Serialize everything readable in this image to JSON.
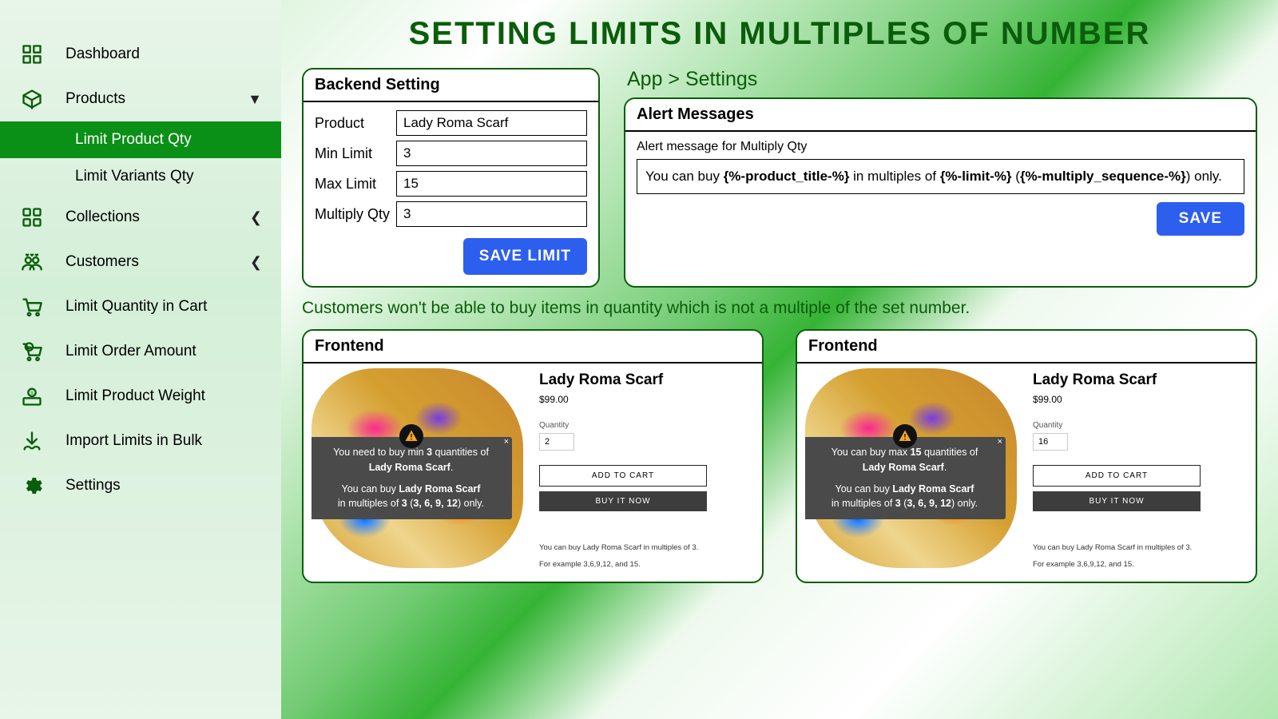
{
  "sidebar": [
    {
      "label": "Dashboard",
      "icon": "dashboard"
    },
    {
      "label": "Products",
      "icon": "box",
      "chev": "down"
    },
    {
      "label": "Limit Product Qty",
      "sub": true,
      "active": true
    },
    {
      "label": "Limit Variants Qty",
      "sub": true
    },
    {
      "label": "Collections",
      "icon": "collections",
      "chev": "left"
    },
    {
      "label": "Customers",
      "icon": "customers",
      "chev": "left"
    },
    {
      "label": "Limit Quantity in Cart",
      "icon": "cart"
    },
    {
      "label": "Limit Order Amount",
      "icon": "amount"
    },
    {
      "label": "Limit Product Weight",
      "icon": "weight"
    },
    {
      "label": "Import Limits in Bulk",
      "icon": "import"
    },
    {
      "label": "Settings",
      "icon": "settings"
    }
  ],
  "pageTitle": "SETTING LIMITS IN MULTIPLES OF NUMBER",
  "backend": {
    "title": "Backend Setting",
    "fields": {
      "product": {
        "label": "Product",
        "value": "Lady Roma Scarf"
      },
      "min": {
        "label": "Min Limit",
        "value": "3"
      },
      "max": {
        "label": "Max Limit",
        "value": "15"
      },
      "mult": {
        "label": "Multiply Qty",
        "value": "3"
      }
    },
    "save": "SAVE LIMIT"
  },
  "breadcrumb": "App > Settings",
  "alerts": {
    "title": "Alert Messages",
    "label": "Alert message for Multiply Qty",
    "text_pre": "You can buy ",
    "tok1": "{%-product_title-%}",
    "text_mid": " in multiples of ",
    "tok2": "{%-limit-%}",
    "text_paren_open": " (",
    "tok3": "{%-multiply_sequence-%}",
    "text_close": ") only.",
    "save": "SAVE"
  },
  "desc": "Customers won't be able to buy items in quantity which is not a multiple of the set number.",
  "frontLeft": {
    "head": "Frontend",
    "title": "Lady Roma Scarf",
    "price": "$99.00",
    "qtyLabel": "Quantity",
    "qty": "2",
    "addCart": "ADD TO CART",
    "buyNow": "BUY IT NOW",
    "hint1": "You can buy Lady Roma Scarf in multiples of 3.",
    "hint2": "For example 3,6,9,12, and 15.",
    "toast": {
      "l1a": "You need to buy min ",
      "l1b": "3",
      "l1c": " quantities of",
      "l2": "Lady Roma Scarf",
      "l3a": "You can buy ",
      "l3b": "Lady Roma Scarf",
      "l4a": "in multiples of ",
      "l4b": "3",
      "l4c": " (",
      "l4d": "3, 6, 9, 12",
      "l4e": ") only."
    }
  },
  "frontRight": {
    "head": "Frontend",
    "title": "Lady Roma Scarf",
    "price": "$99.00",
    "qtyLabel": "Quantity",
    "qty": "16",
    "addCart": "ADD TO CART",
    "buyNow": "BUY IT NOW",
    "hint1": "You can buy Lady Roma Scarf in multiples of 3.",
    "hint2": "For example 3,6,9,12, and 15.",
    "toast": {
      "l1a": "You can buy max ",
      "l1b": "15",
      "l1c": " quantities of",
      "l2": "Lady Roma Scarf",
      "l3a": "You can buy ",
      "l3b": "Lady Roma Scarf",
      "l4a": "in multiples of ",
      "l4b": "3",
      "l4c": " (",
      "l4d": "3, 6, 9, 12",
      "l4e": ") only."
    }
  }
}
